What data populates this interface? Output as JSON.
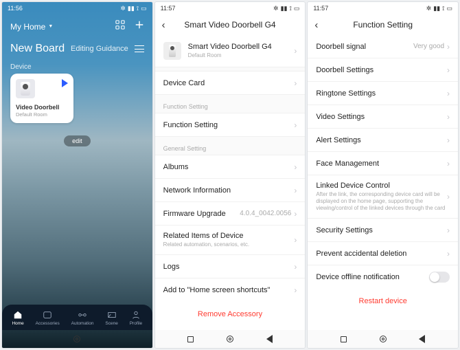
{
  "left": {
    "time": "11:56",
    "home_label": "My Home",
    "board_title": "New Board",
    "editing_guidance": "Editing Guidance",
    "section": "Device",
    "device": {
      "name": "Video Doorbell",
      "room": "Default Room"
    },
    "edit_label": "edit",
    "tabs": [
      "Home",
      "Accessories",
      "Automation",
      "Scene",
      "Profile"
    ]
  },
  "mid": {
    "time": "11:57",
    "title": "Smart Video Doorbell G4",
    "device": {
      "name": "Smart Video Doorbell G4",
      "room": "Default Room"
    },
    "items": {
      "device_card": "Device Card",
      "function_section": "Function Setting",
      "function_setting": "Function Setting",
      "general_section": "General Setting",
      "albums": "Albums",
      "network": "Network Information",
      "firmware": "Firmware Upgrade",
      "firmware_val": "4.0.4_0042.0056",
      "related": "Related Items of Device",
      "related_sub": "Related automation, scenarios, etc.",
      "logs": "Logs",
      "shortcut": "Add to \"Home screen shortcuts\"",
      "remove": "Remove Accessory"
    }
  },
  "right": {
    "time": "11:57",
    "title": "Function Setting",
    "items": {
      "signal": "Doorbell signal",
      "signal_val": "Very good",
      "doorbell_settings": "Doorbell Settings",
      "ringtone": "Ringtone Settings",
      "video": "Video Settings",
      "alert": "Alert Settings",
      "face": "Face Management",
      "linked": "Linked Device Control",
      "linked_sub": "After the link, the corresponding device card will be displayed on the home page, supporting the viewing/control of the linked devices through the card",
      "security": "Security Settings",
      "prevent": "Prevent accidental deletion",
      "offline": "Device offline notification",
      "restart": "Restart device"
    }
  }
}
